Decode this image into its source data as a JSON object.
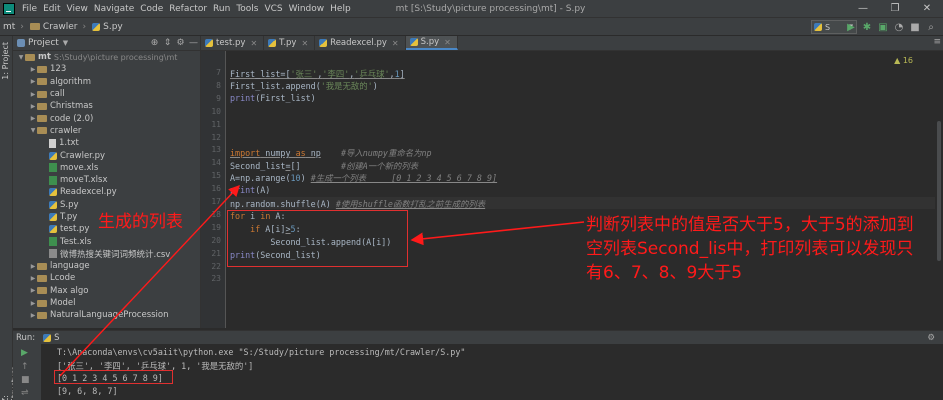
{
  "menubar": {
    "items": [
      "File",
      "Edit",
      "View",
      "Navigate",
      "Code",
      "Refactor",
      "Run",
      "Tools",
      "VCS",
      "Window",
      "Help"
    ],
    "title": "mt [S:\\Study\\picture processing\\mt] - S.py",
    "controls": [
      "—",
      "❐",
      "✕"
    ]
  },
  "navbar": {
    "crumbs": [
      "mt",
      "Crawler",
      "S.py"
    ],
    "run_config": "S"
  },
  "sidebar": {
    "project_tab": "1: Project",
    "structure_tab": "Z: Structure"
  },
  "project": {
    "title": "Project",
    "root_name": "mt",
    "root_path": "S:\\Study\\picture processing\\mt",
    "items": [
      {
        "label": "123",
        "type": "folder",
        "depth": 1,
        "arrow": "▶"
      },
      {
        "label": "algorithm",
        "type": "folder",
        "depth": 1,
        "arrow": "▶"
      },
      {
        "label": "call",
        "type": "folder",
        "depth": 1,
        "arrow": "▶"
      },
      {
        "label": "Christmas",
        "type": "folder",
        "depth": 1,
        "arrow": "▶"
      },
      {
        "label": "code  (2.0)",
        "type": "folder",
        "depth": 1,
        "arrow": "▶"
      },
      {
        "label": "crawler",
        "type": "folder",
        "depth": 1,
        "arrow": "▼"
      },
      {
        "label": "1.txt",
        "type": "txt",
        "depth": 2,
        "arrow": ""
      },
      {
        "label": "Crawler.py",
        "type": "py",
        "depth": 2,
        "arrow": ""
      },
      {
        "label": "move.xls",
        "type": "xls",
        "depth": 2,
        "arrow": ""
      },
      {
        "label": "moveT.xlsx",
        "type": "xls",
        "depth": 2,
        "arrow": ""
      },
      {
        "label": "Readexcel.py",
        "type": "py",
        "depth": 2,
        "arrow": ""
      },
      {
        "label": "S.py",
        "type": "py",
        "depth": 2,
        "arrow": ""
      },
      {
        "label": "T.py",
        "type": "py",
        "depth": 2,
        "arrow": ""
      },
      {
        "label": "test.py",
        "type": "py",
        "depth": 2,
        "arrow": ""
      },
      {
        "label": "Test.xls",
        "type": "xls",
        "depth": 2,
        "arrow": ""
      },
      {
        "label": "微博热搜关键词词频统计.csv",
        "type": "csv",
        "depth": 2,
        "arrow": ""
      },
      {
        "label": "language",
        "type": "folder",
        "depth": 1,
        "arrow": "▶"
      },
      {
        "label": "Lcode",
        "type": "folder",
        "depth": 1,
        "arrow": "▶"
      },
      {
        "label": "Max algo",
        "type": "folder",
        "depth": 1,
        "arrow": "▶"
      },
      {
        "label": "Model",
        "type": "folder",
        "depth": 1,
        "arrow": "▶"
      },
      {
        "label": "NaturalLanguageProcession",
        "type": "folder",
        "depth": 1,
        "arrow": "▶"
      }
    ]
  },
  "tabs": [
    {
      "label": "test.py",
      "active": false
    },
    {
      "label": "T.py",
      "active": false
    },
    {
      "label": "Readexcel.py",
      "active": false
    },
    {
      "label": "S.py",
      "active": true
    }
  ],
  "editor": {
    "warning": "▲ 16",
    "line_numbers": [
      "7",
      "8",
      "9",
      "10",
      "11",
      "12",
      "13",
      "14",
      "15",
      "16",
      "17",
      "18",
      "19",
      "20",
      "21",
      "22",
      "23"
    ]
  },
  "run": {
    "label": "Run:",
    "config": "S",
    "lines": [
      "T:\\Anaconda\\envs\\cv5aiit\\python.exe \"S:/Study/picture processing/mt/Crawler/S.py\"",
      "['张三', '李四', '乒乓球', 1, '我是无敌的']",
      "[0 1 2 3 4 5 6 7 8 9]",
      "[9, 6, 8, 7]"
    ]
  },
  "annotations": {
    "left": "生成的列表",
    "right_lines": [
      "判断列表中的值是否大于5，大于5的添加到",
      "空列表Second_lis中，打印列表可以发现只",
      "有6、7、8、9大于5"
    ],
    "color": "#ff1a1a"
  }
}
